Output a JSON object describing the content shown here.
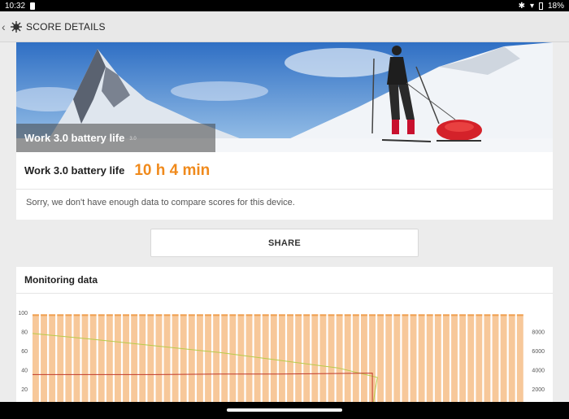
{
  "status_bar": {
    "time": "10:32",
    "battery": "18%"
  },
  "app_bar": {
    "title": "SCORE DETAILS"
  },
  "hero": {
    "test_name": "Work 3.0 battery life",
    "version": "3.0"
  },
  "score": {
    "label": "Work 3.0 battery life",
    "value": "10 h 4 min"
  },
  "compare_note": "Sorry, we don't have enough data to compare scores for this device.",
  "share_label": "SHARE",
  "monitoring": {
    "title": "Monitoring data"
  },
  "colors": {
    "accent": "#f08a1c",
    "bar_fill": "#f7c89a",
    "bar_top": "#f0a050",
    "battery_line": "#b8cc4a",
    "cpu_line": "#c0392b"
  },
  "chart_data": {
    "type": "bar",
    "left_ticks": [
      "100",
      "80",
      "60",
      "40",
      "20"
    ],
    "right_ticks": [
      "8000",
      "6000",
      "4000",
      "2000"
    ],
    "bar_count": 60,
    "bar_value": 98,
    "left_ylim": [
      0,
      100
    ],
    "right_ylim": [
      0,
      10000
    ],
    "series": [
      {
        "x": [
          0,
          0.12,
          0.25,
          0.38,
          0.5,
          0.62,
          0.7,
          0.69
        ],
        "values": [
          78,
          72,
          65,
          58,
          50,
          42,
          32,
          0
        ]
      },
      {
        "x": [
          0,
          0.25,
          0.38,
          0.5,
          0.69,
          0.69
        ],
        "values": [
          3500,
          3500,
          3550,
          3550,
          3650,
          0
        ]
      }
    ]
  }
}
